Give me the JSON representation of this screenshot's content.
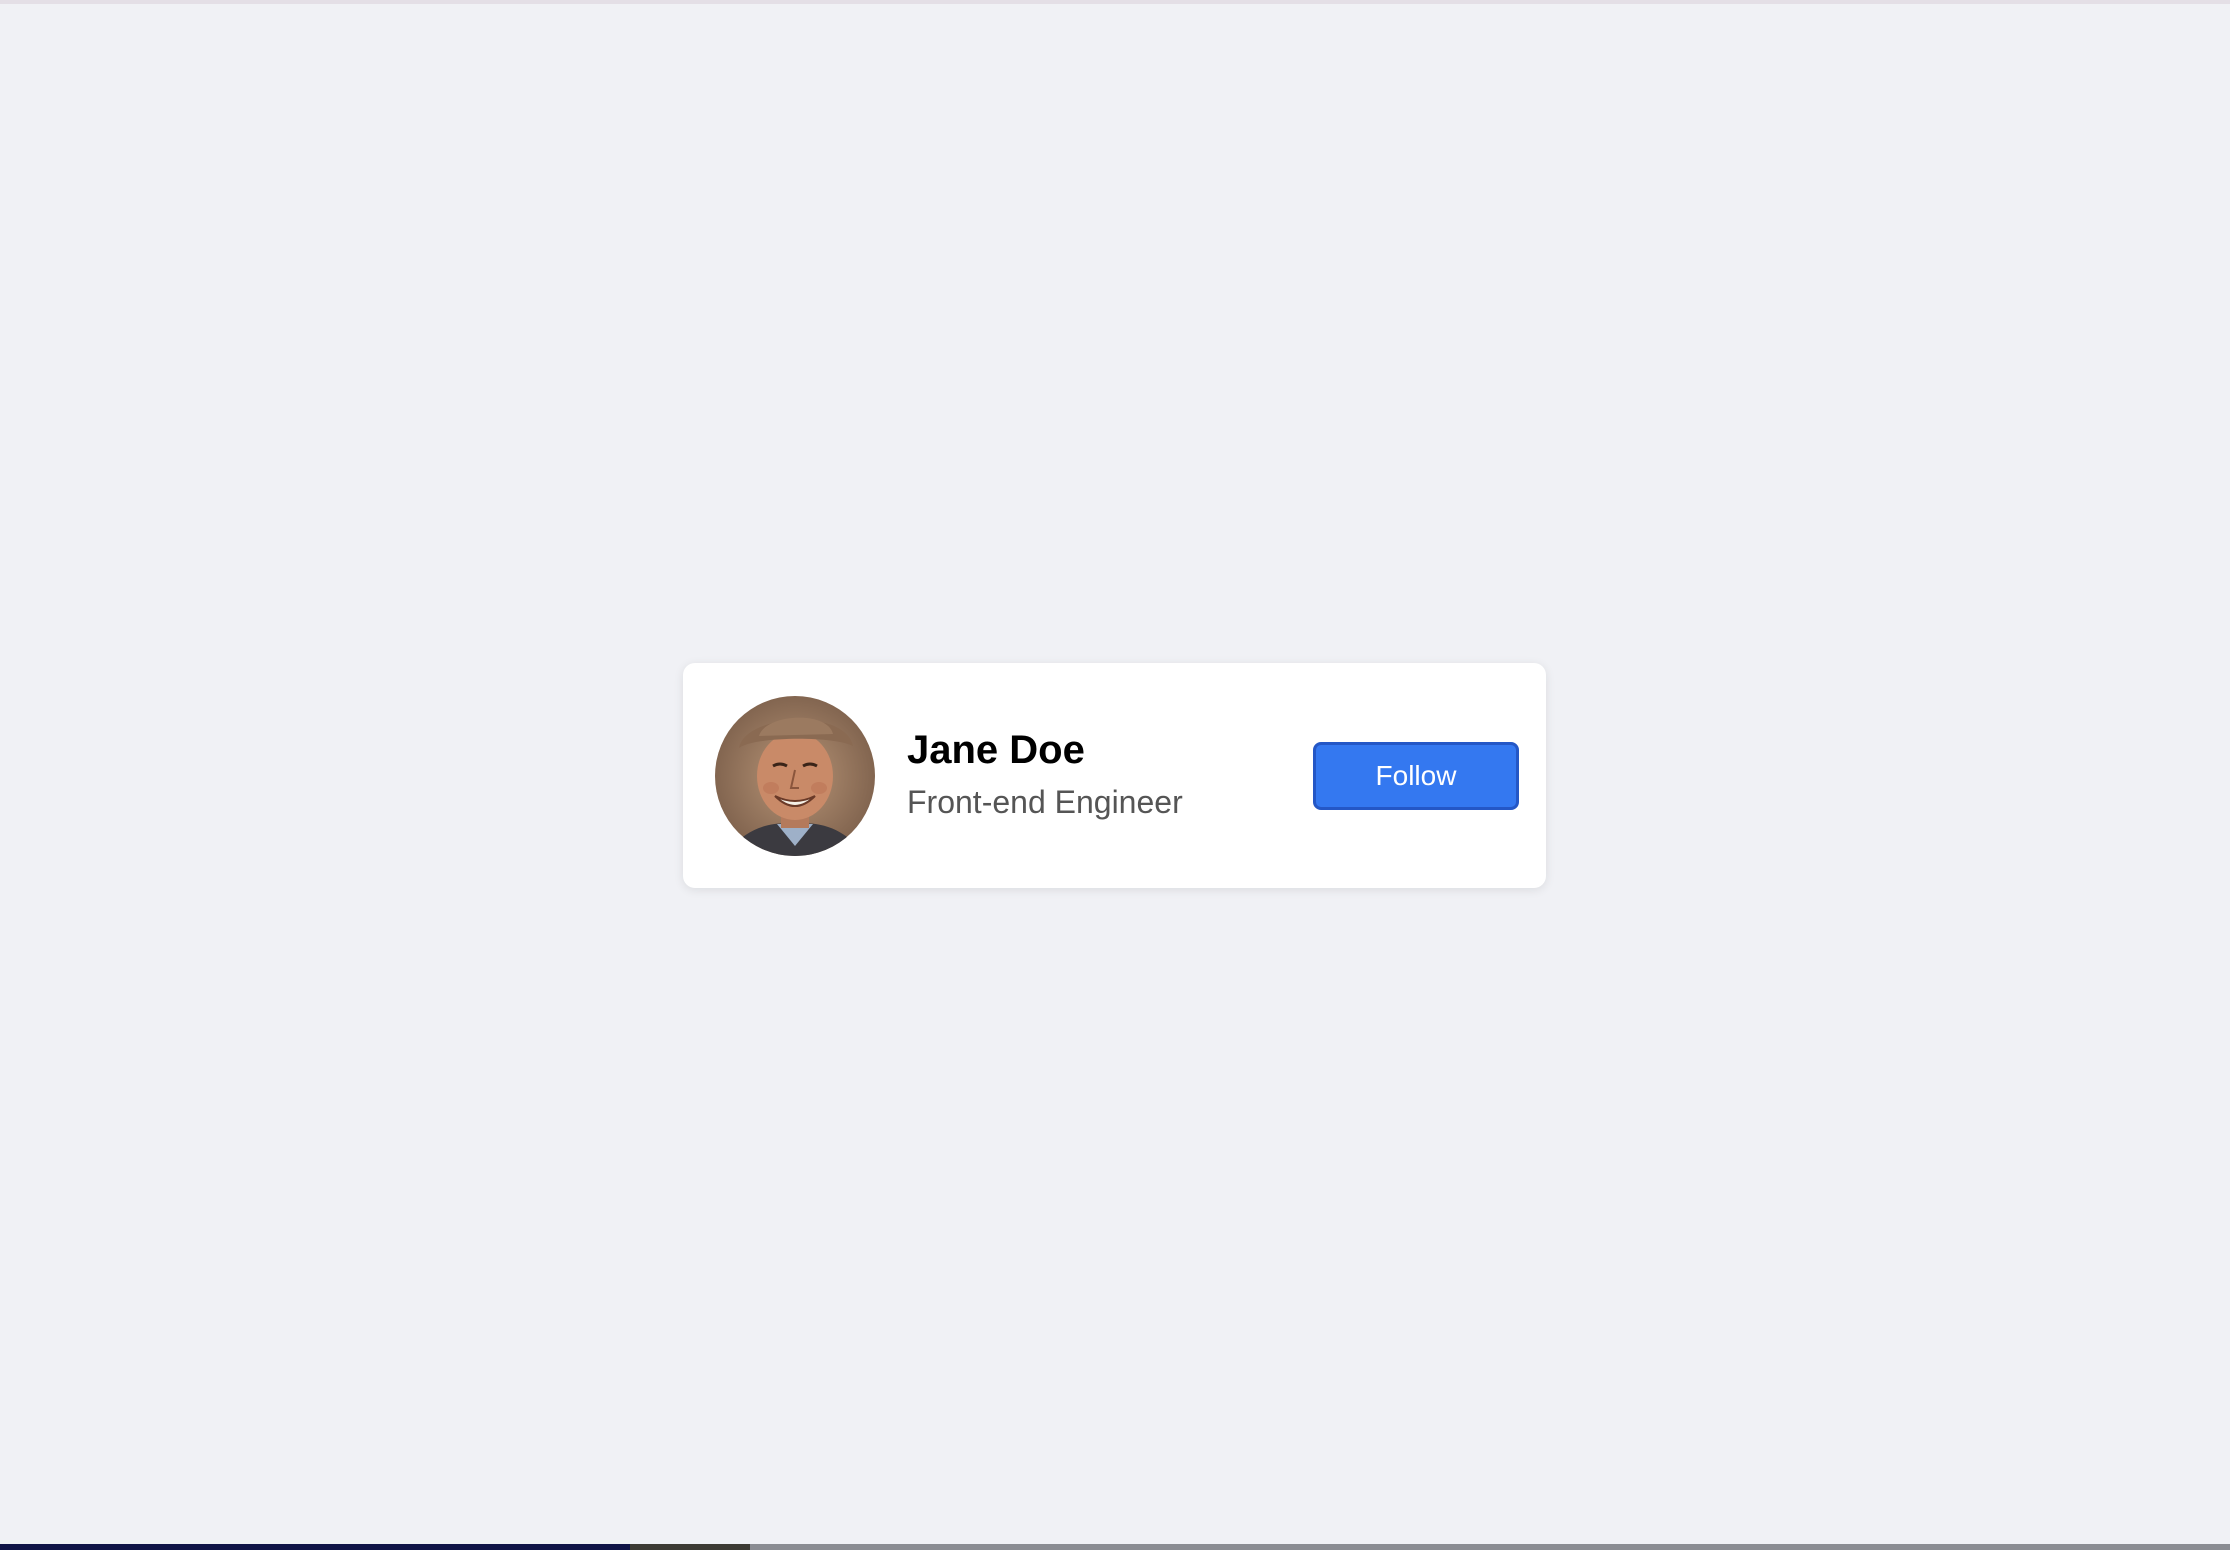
{
  "profile_card": {
    "name": "Jane Doe",
    "role": "Front-end Engineer",
    "follow_label": "Follow",
    "avatar_alt": "avatar"
  },
  "colors": {
    "background": "#f0f1f5",
    "card": "#ffffff",
    "button": "#3478f0",
    "button_border": "#2457c6",
    "name_text": "#000000",
    "role_text": "#555555"
  }
}
